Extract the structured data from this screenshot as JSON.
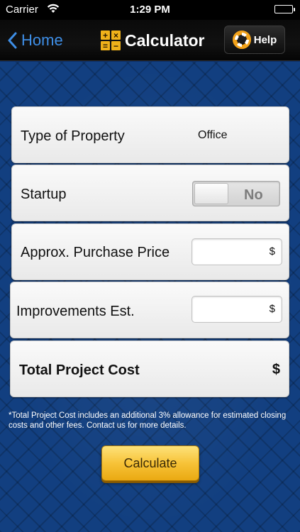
{
  "status_bar": {
    "carrier": "Carrier",
    "time": "1:29 PM",
    "wifi_icon": "wifi-icon",
    "battery_icon": "battery-icon",
    "battery_level": 1.0
  },
  "nav_bar": {
    "back_label": "Home",
    "back_icon": "chevron-left-icon",
    "title": "Calculator",
    "title_icon": "calculator-icon",
    "calc_icon_symbols": [
      "+",
      "×",
      "=",
      "−"
    ],
    "help_label": "Help",
    "help_icon": "lifebuoy-icon"
  },
  "form": {
    "property_type": {
      "label": "Type of Property",
      "value": "Office"
    },
    "startup": {
      "label": "Startup",
      "toggle_value": "No"
    },
    "purchase_price": {
      "label": "Approx. Purchase Price",
      "currency_symbol": "$",
      "value": ""
    },
    "improvements": {
      "label": "Improvements Est.",
      "currency_symbol": "$",
      "value": ""
    },
    "total_cost": {
      "label": "Total Project Cost",
      "value": "$"
    }
  },
  "footnote": "*Total Project Cost includes an additional 3% allowance for estimated closing costs and other fees. Contact us for more details.",
  "calculate_button": "Calculate",
  "colors": {
    "accent_blue": "#3e8ee6",
    "background_blue": "#123f80",
    "button_gold": "#f7c338",
    "icon_gold": "#f0b21a"
  }
}
